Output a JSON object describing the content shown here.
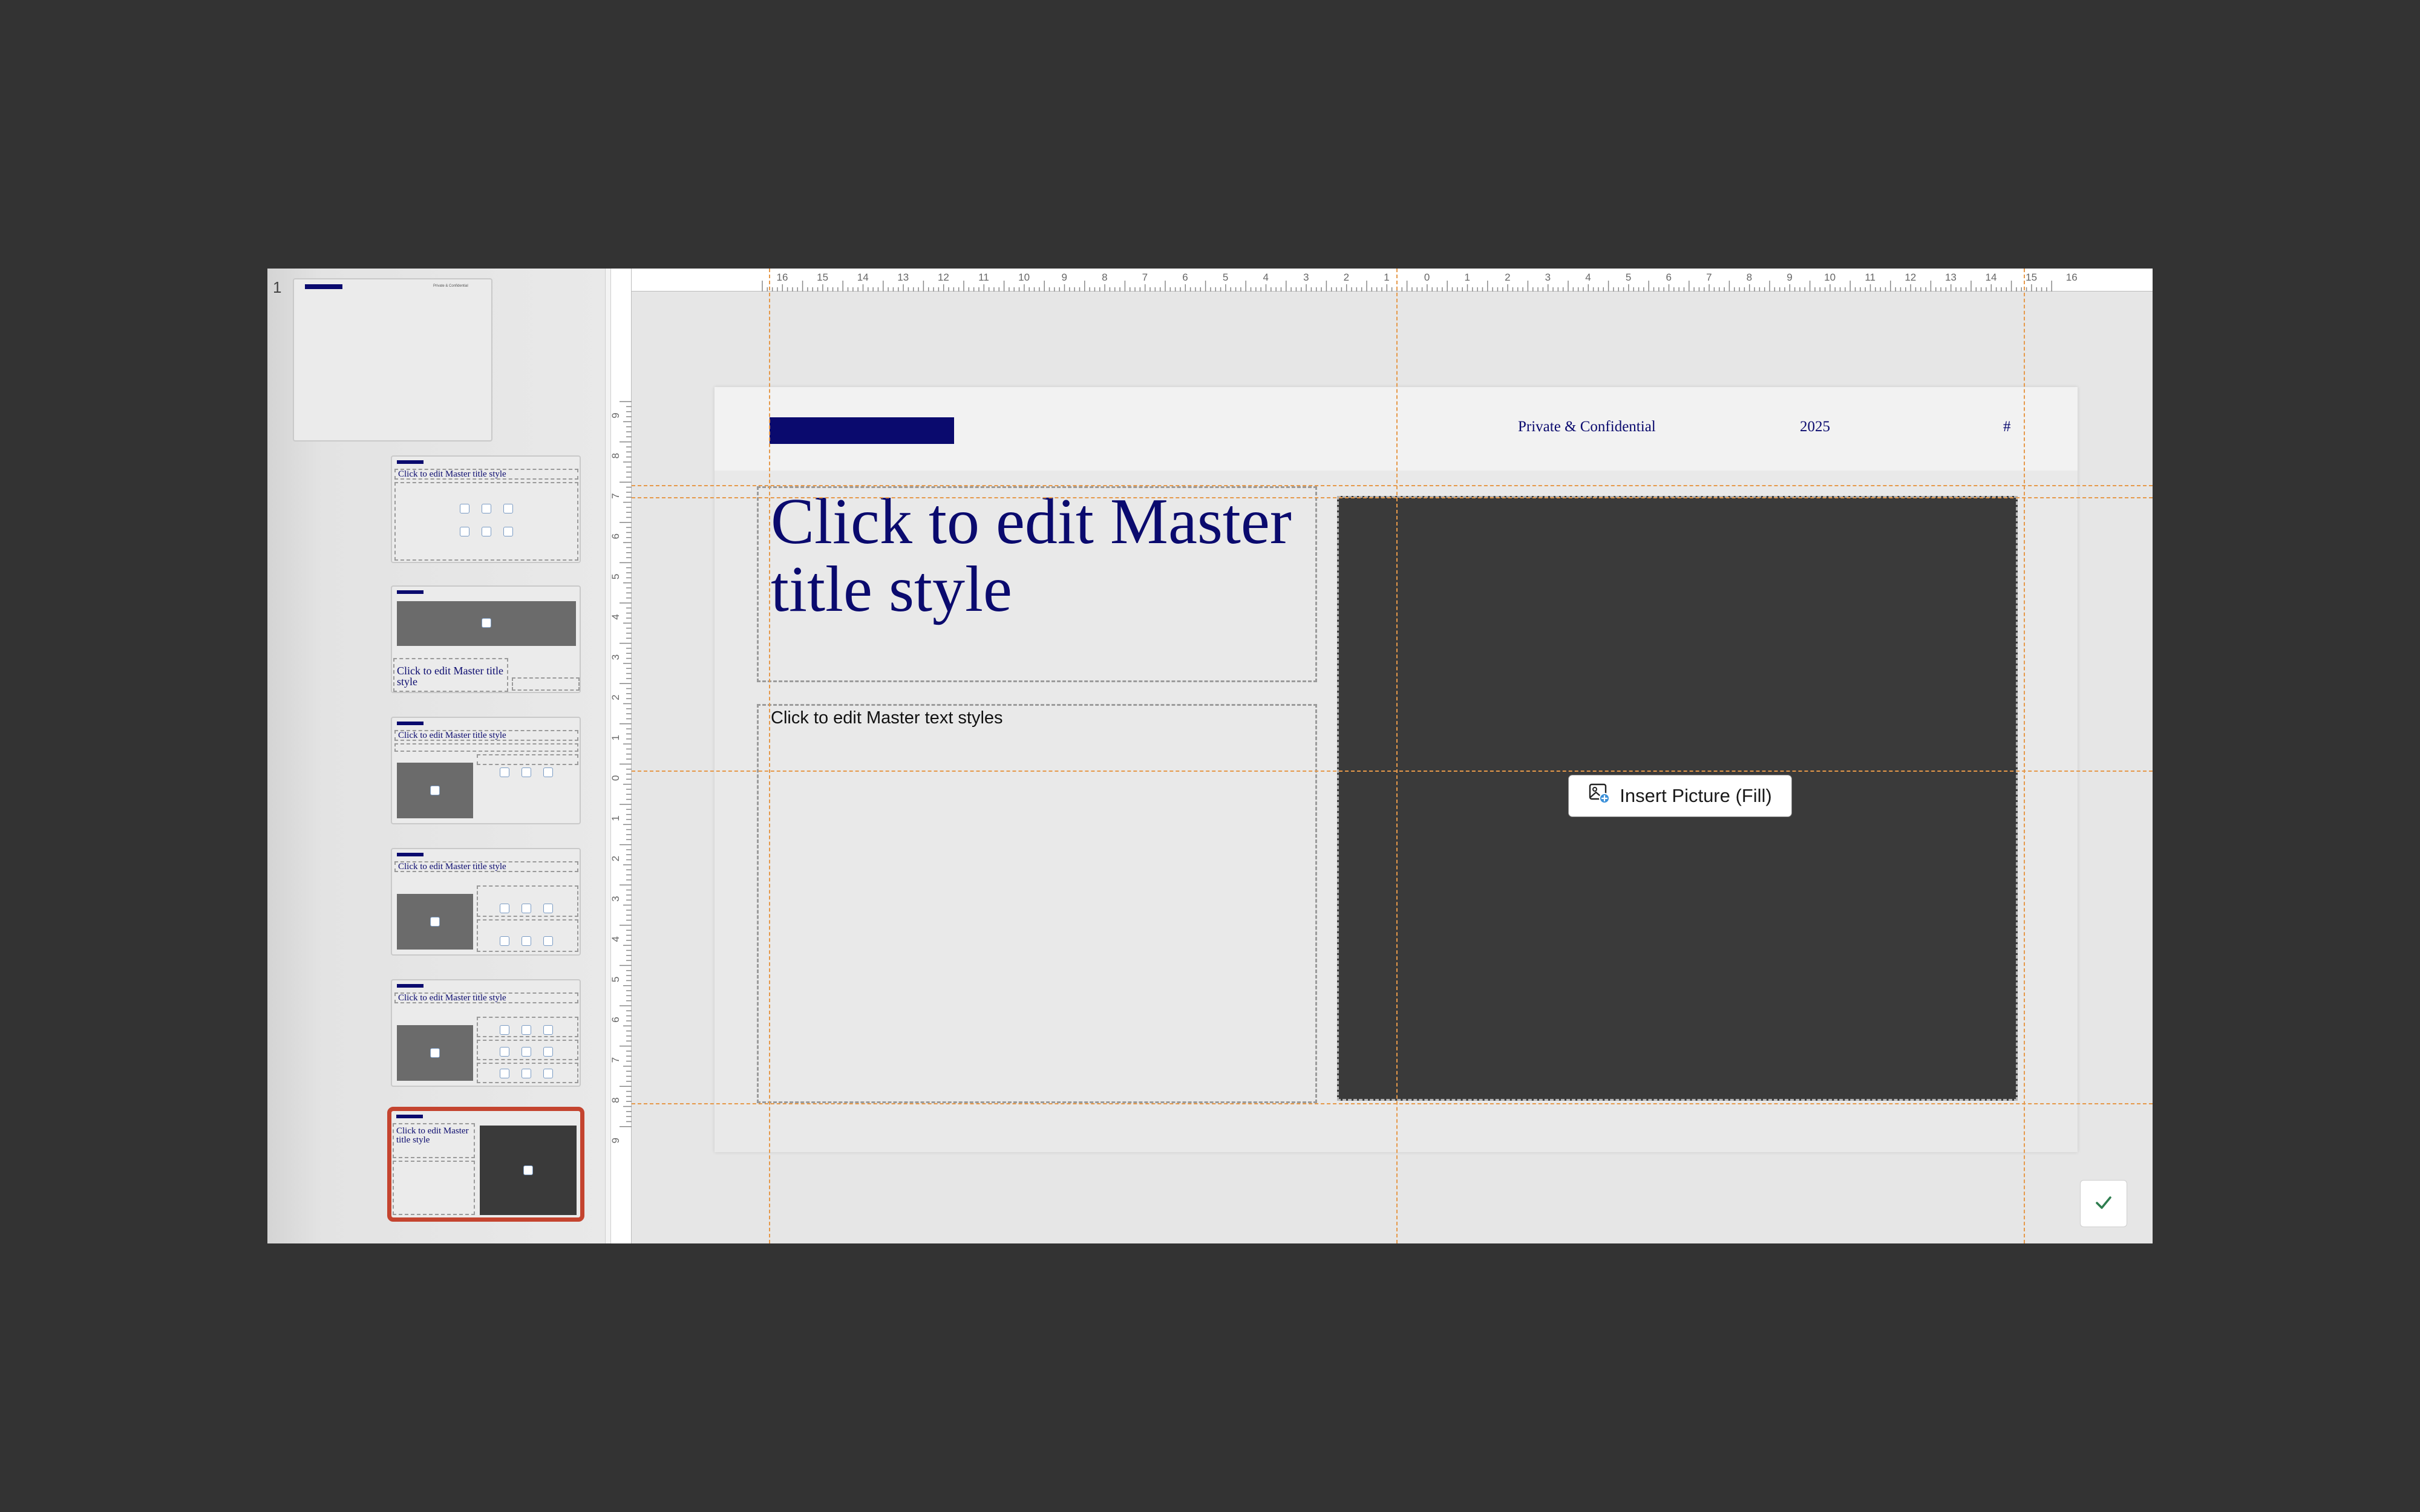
{
  "thumbnails": {
    "slide_number": "1",
    "header_text": "Private & Confidential",
    "header_year": "2025",
    "header_page": "#",
    "master_title": "Click to edit Master title style",
    "body_text_small": "Click to edit Master text styles"
  },
  "slide": {
    "header": {
      "confidential": "Private & Confidential",
      "year": "2025",
      "page_number": "#"
    },
    "title_placeholder": "Click to edit Master title style",
    "body_placeholder": "Click to edit Master text styles",
    "picture_placeholder": {
      "button_label": "Insert Picture (Fill)"
    }
  },
  "ruler": {
    "horizontal_labels": [
      "16",
      "15",
      "14",
      "13",
      "12",
      "11",
      "10",
      "9",
      "8",
      "7",
      "6",
      "5",
      "4",
      "3",
      "2",
      "1",
      "0",
      "1",
      "2",
      "3",
      "4",
      "5",
      "6",
      "7",
      "8",
      "9",
      "10",
      "11",
      "12",
      "13",
      "14",
      "15",
      "16"
    ],
    "vertical_labels": [
      "9",
      "8",
      "7",
      "6",
      "5",
      "4",
      "3",
      "2",
      "1",
      "0",
      "1",
      "2",
      "3",
      "4",
      "5",
      "6",
      "7",
      "8",
      "9"
    ]
  },
  "colors": {
    "accent_navy": "#0a0a6e",
    "selection": "#c4442f",
    "guide": "#e6994a"
  },
  "icons": {
    "insert_picture": "picture-icon",
    "done": "checkmark-icon"
  }
}
